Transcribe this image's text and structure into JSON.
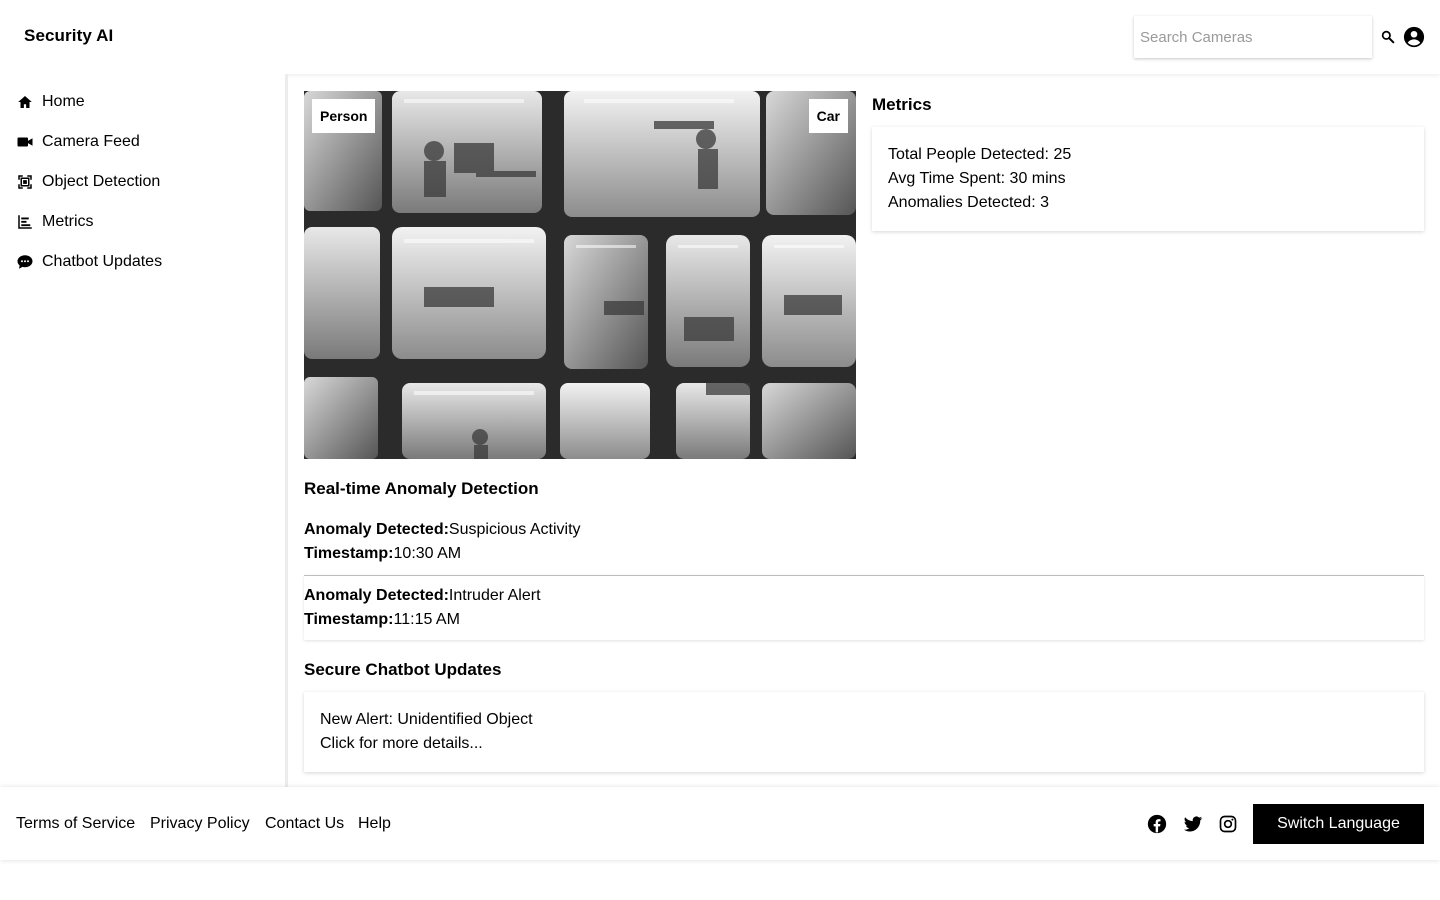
{
  "header": {
    "app_title": "Security AI",
    "search": {
      "placeholder": "Search Cameras",
      "value": ""
    },
    "icons": {
      "search": "search-icon",
      "account": "account-circle-icon"
    }
  },
  "sidebar": {
    "items": [
      {
        "label": "Home",
        "icon": "home-icon"
      },
      {
        "label": "Camera Feed",
        "icon": "videocam-icon"
      },
      {
        "label": "Object Detection",
        "icon": "object-detection-icon"
      },
      {
        "label": "Metrics",
        "icon": "bar-chart-icon"
      },
      {
        "label": "Chatbot Updates",
        "icon": "chat-icon"
      }
    ]
  },
  "camera_feed": {
    "labels": {
      "person": "Person",
      "car": "Car"
    }
  },
  "metrics": {
    "title": "Metrics",
    "lines": [
      "Total People Detected: 25",
      "Avg Time Spent: 30 mins",
      "Anomalies Detected: 3"
    ]
  },
  "anomaly": {
    "title": "Real-time Anomaly Detection",
    "entries": [
      {
        "anomaly_label": "Anomaly Detected:",
        "anomaly_value": "Suspicious Activity",
        "timestamp_label": "Timestamp:",
        "timestamp_value": "10:30 AM"
      },
      {
        "anomaly_label": "Anomaly Detected:",
        "anomaly_value": "Intruder Alert",
        "timestamp_label": "Timestamp:",
        "timestamp_value": "11:15 AM"
      }
    ]
  },
  "chatbot": {
    "title": "Secure Chatbot Updates",
    "message_line1": "New Alert: Unidentified Object",
    "message_line2": "Click for more details..."
  },
  "footer": {
    "links": [
      "Terms of Service",
      "Privacy Policy",
      "Contact Us",
      "Help"
    ],
    "social_icons": [
      "facebook-icon",
      "twitter-icon",
      "instagram-icon"
    ],
    "language_button": "Switch Language"
  },
  "colors": {
    "primary_button": "#000000",
    "background": "#ffffff",
    "text": "#000000"
  }
}
